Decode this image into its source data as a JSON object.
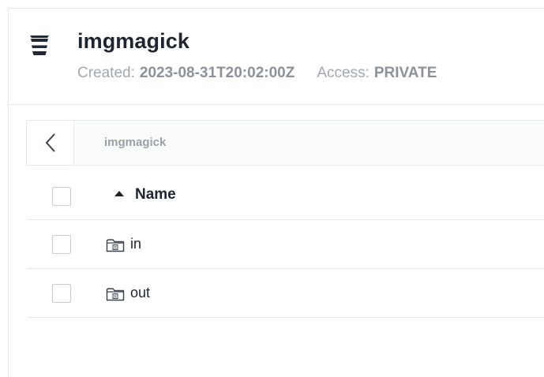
{
  "bucket": {
    "name": "imgmagick",
    "created_label": "Created:",
    "created_value": "2023-08-31T20:02:00Z",
    "access_label": "Access:",
    "access_value": "PRIVATE",
    "icon": "bucket-icon"
  },
  "breadcrumb": {
    "back_icon": "chevron-left-icon",
    "path": "imgmagick"
  },
  "table": {
    "columns": [
      {
        "label": "Name",
        "sort": "ascending"
      }
    ],
    "rows": [
      {
        "name": "in",
        "type": "folder",
        "icon": "folder-icon"
      },
      {
        "name": "out",
        "type": "folder",
        "icon": "folder-icon"
      }
    ]
  },
  "colors": {
    "text_primary": "#1e2530",
    "text_muted": "#a2a8ae",
    "border": "#e6e8eb"
  }
}
